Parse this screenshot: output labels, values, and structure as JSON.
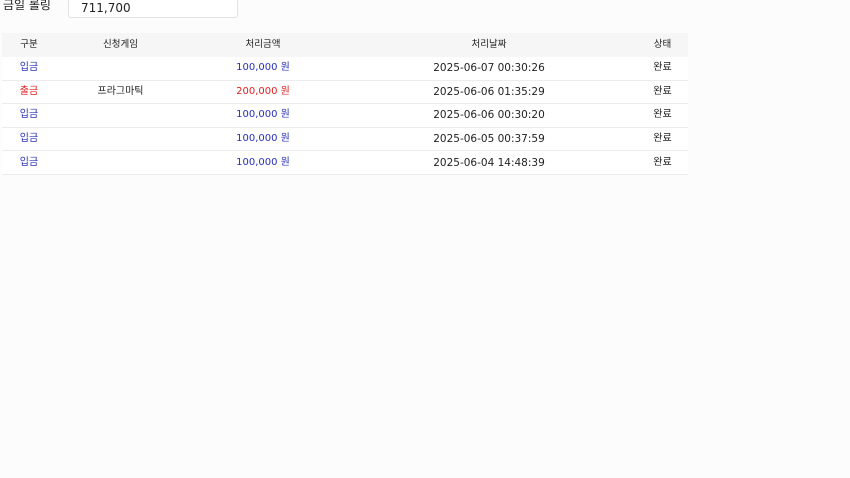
{
  "rolling": {
    "label": "금일 롤링",
    "value": "711,700"
  },
  "table": {
    "headers": [
      "구분",
      "신청게임",
      "처리금액",
      "처리날짜",
      "상태"
    ],
    "rows": [
      {
        "type": "입금",
        "type_kind": "dep",
        "game": "",
        "amount": "100,000 원",
        "date": "2025-06-07 00:30:26",
        "status": "완료"
      },
      {
        "type": "출금",
        "type_kind": "wd",
        "game": "프라그마틱",
        "amount": "200,000 원",
        "date": "2025-06-06 01:35:29",
        "status": "완료"
      },
      {
        "type": "입금",
        "type_kind": "dep",
        "game": "",
        "amount": "100,000 원",
        "date": "2025-06-06 00:30:20",
        "status": "완료"
      },
      {
        "type": "입금",
        "type_kind": "dep",
        "game": "",
        "amount": "100,000 원",
        "date": "2025-06-05 00:37:59",
        "status": "완료"
      },
      {
        "type": "입금",
        "type_kind": "dep",
        "game": "",
        "amount": "100,000 원",
        "date": "2025-06-04 14:48:39",
        "status": "완료"
      }
    ]
  },
  "colors": {
    "deposit": "#2830b8",
    "withdraw": "#e02020"
  }
}
